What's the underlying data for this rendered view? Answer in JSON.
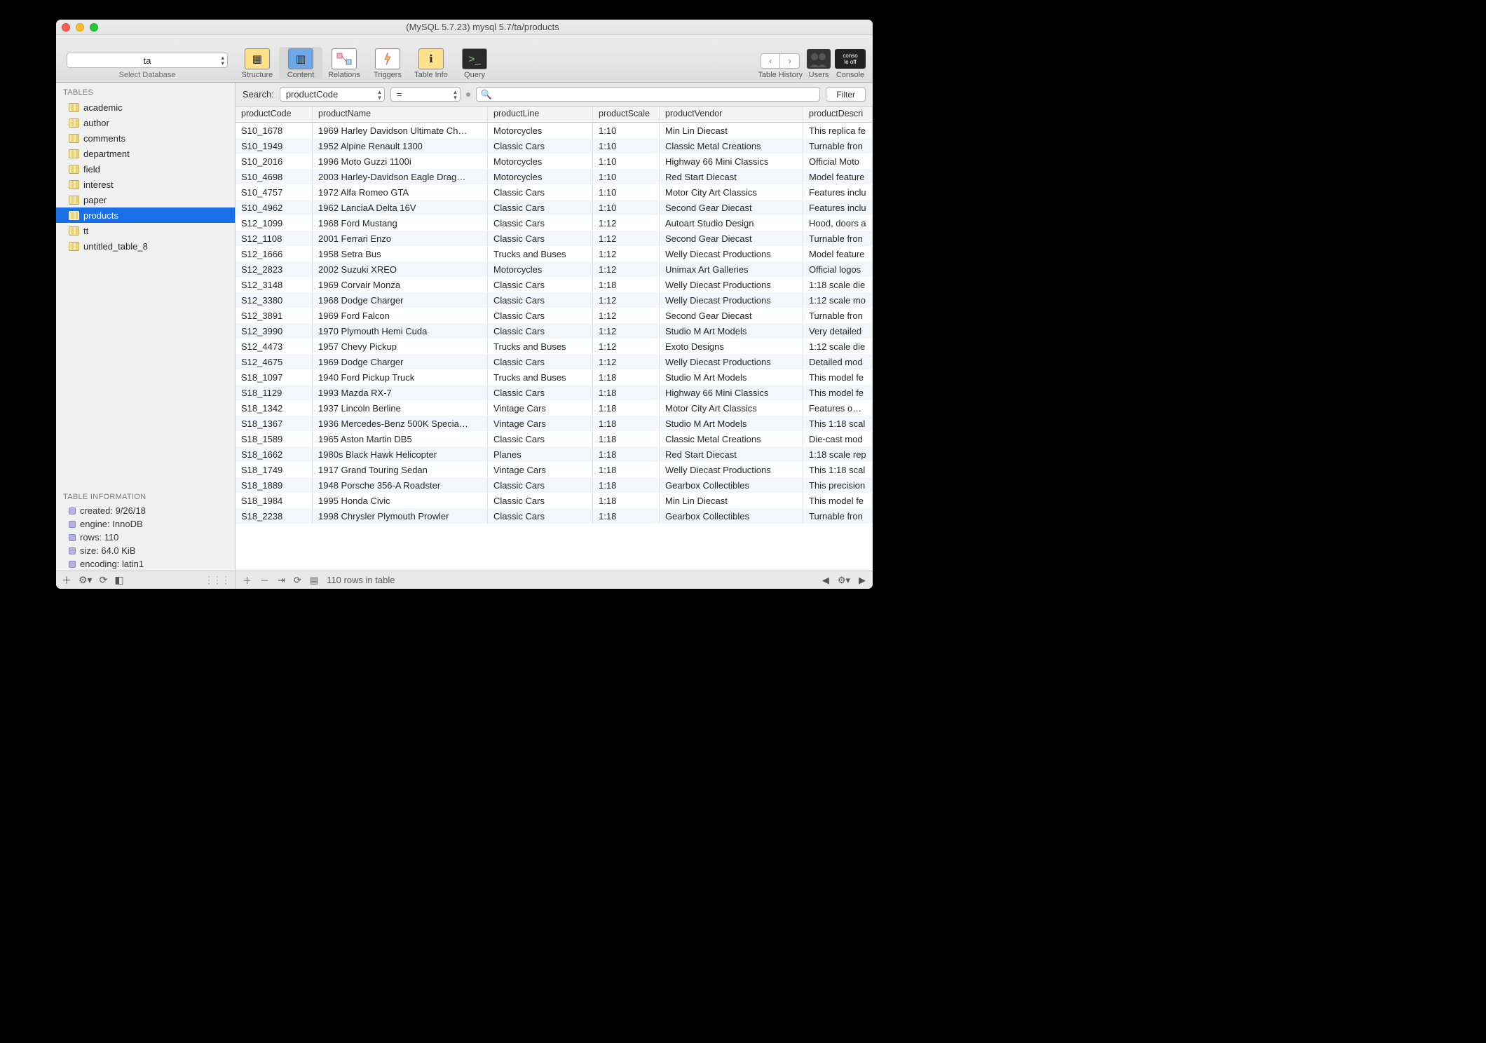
{
  "window": {
    "title": "(MySQL 5.7.23) mysql 5.7/ta/products"
  },
  "toolbar": {
    "selected_db": "ta",
    "select_db_label": "Select Database",
    "buttons": {
      "structure": "Structure",
      "content": "Content",
      "relations": "Relations",
      "triggers": "Triggers",
      "table_info": "Table Info",
      "query": "Query"
    },
    "history_label": "Table History",
    "users_label": "Users",
    "console_label": "Console",
    "console_badge": "conso\nle off"
  },
  "sidebar": {
    "tables_label": "TABLES",
    "tables": [
      "academic",
      "author",
      "comments",
      "department",
      "field",
      "interest",
      "paper",
      "products",
      "tt",
      "untitled_table_8"
    ],
    "selected_table": "products",
    "info_label": "TABLE INFORMATION",
    "info": {
      "created": "created: 9/26/18",
      "engine": "engine: InnoDB",
      "rows": "rows: 110",
      "size": "size: 64.0 KiB",
      "encoding": "encoding: latin1"
    }
  },
  "search": {
    "label": "Search:",
    "field": "productCode",
    "operator": "=",
    "value": "",
    "filter_button": "Filter"
  },
  "columns": [
    "productCode",
    "productName",
    "productLine",
    "productScale",
    "productVendor",
    "productDescri"
  ],
  "rows": [
    [
      "S10_1678",
      "1969 Harley Davidson Ultimate Ch…",
      "Motorcycles",
      "1:10",
      "Min Lin Diecast",
      "This replica fe"
    ],
    [
      "S10_1949",
      "1952 Alpine Renault 1300",
      "Classic Cars",
      "1:10",
      "Classic Metal Creations",
      "Turnable fron"
    ],
    [
      "S10_2016",
      "1996 Moto Guzzi 1100i",
      "Motorcycles",
      "1:10",
      "Highway 66 Mini Classics",
      "Official Moto"
    ],
    [
      "S10_4698",
      "2003 Harley-Davidson Eagle Drag…",
      "Motorcycles",
      "1:10",
      "Red Start Diecast",
      "Model feature"
    ],
    [
      "S10_4757",
      "1972 Alfa Romeo GTA",
      "Classic Cars",
      "1:10",
      "Motor City Art Classics",
      "Features inclu"
    ],
    [
      "S10_4962",
      "1962 LanciaA Delta 16V",
      "Classic Cars",
      "1:10",
      "Second Gear Diecast",
      "Features inclu"
    ],
    [
      "S12_1099",
      "1968 Ford Mustang",
      "Classic Cars",
      "1:12",
      "Autoart Studio Design",
      "Hood, doors a"
    ],
    [
      "S12_1108",
      "2001 Ferrari Enzo",
      "Classic Cars",
      "1:12",
      "Second Gear Diecast",
      "Turnable fron"
    ],
    [
      "S12_1666",
      "1958 Setra Bus",
      "Trucks and Buses",
      "1:12",
      "Welly Diecast Productions",
      "Model feature"
    ],
    [
      "S12_2823",
      "2002 Suzuki XREO",
      "Motorcycles",
      "1:12",
      "Unimax Art Galleries",
      "Official logos"
    ],
    [
      "S12_3148",
      "1969 Corvair Monza",
      "Classic Cars",
      "1:18",
      "Welly Diecast Productions",
      "1:18 scale die"
    ],
    [
      "S12_3380",
      "1968 Dodge Charger",
      "Classic Cars",
      "1:12",
      "Welly Diecast Productions",
      "1:12 scale mo"
    ],
    [
      "S12_3891",
      "1969 Ford Falcon",
      "Classic Cars",
      "1:12",
      "Second Gear Diecast",
      "Turnable fron"
    ],
    [
      "S12_3990",
      "1970 Plymouth Hemi Cuda",
      "Classic Cars",
      "1:12",
      "Studio M Art Models",
      "Very detailed"
    ],
    [
      "S12_4473",
      "1957 Chevy Pickup",
      "Trucks and Buses",
      "1:12",
      "Exoto Designs",
      "1:12 scale die"
    ],
    [
      "S12_4675",
      "1969 Dodge Charger",
      "Classic Cars",
      "1:12",
      "Welly Diecast Productions",
      "Detailed mod"
    ],
    [
      "S18_1097",
      "1940 Ford Pickup Truck",
      "Trucks and Buses",
      "1:18",
      "Studio M Art Models",
      "This model fe"
    ],
    [
      "S18_1129",
      "1993 Mazda RX-7",
      "Classic Cars",
      "1:18",
      "Highway 66 Mini Classics",
      "This model fe"
    ],
    [
      "S18_1342",
      "1937 Lincoln Berline",
      "Vintage Cars",
      "1:18",
      "Motor City Art Classics",
      "Features open"
    ],
    [
      "S18_1367",
      "1936 Mercedes-Benz 500K Specia…",
      "Vintage Cars",
      "1:18",
      "Studio M Art Models",
      "This 1:18 scal"
    ],
    [
      "S18_1589",
      "1965 Aston Martin DB5",
      "Classic Cars",
      "1:18",
      "Classic Metal Creations",
      "Die-cast mod"
    ],
    [
      "S18_1662",
      "1980s Black Hawk Helicopter",
      "Planes",
      "1:18",
      "Red Start Diecast",
      "1:18 scale rep"
    ],
    [
      "S18_1749",
      "1917 Grand Touring Sedan",
      "Vintage Cars",
      "1:18",
      "Welly Diecast Productions",
      "This 1:18 scal"
    ],
    [
      "S18_1889",
      "1948 Porsche 356-A Roadster",
      "Classic Cars",
      "1:18",
      "Gearbox Collectibles",
      "This precision"
    ],
    [
      "S18_1984",
      "1995 Honda Civic",
      "Classic Cars",
      "1:18",
      "Min Lin Diecast",
      "This model fe"
    ],
    [
      "S18_2238",
      "1998 Chrysler Plymouth Prowler",
      "Classic Cars",
      "1:18",
      "Gearbox Collectibles",
      "Turnable fron"
    ]
  ],
  "status": {
    "rows_text": "110 rows in table"
  }
}
